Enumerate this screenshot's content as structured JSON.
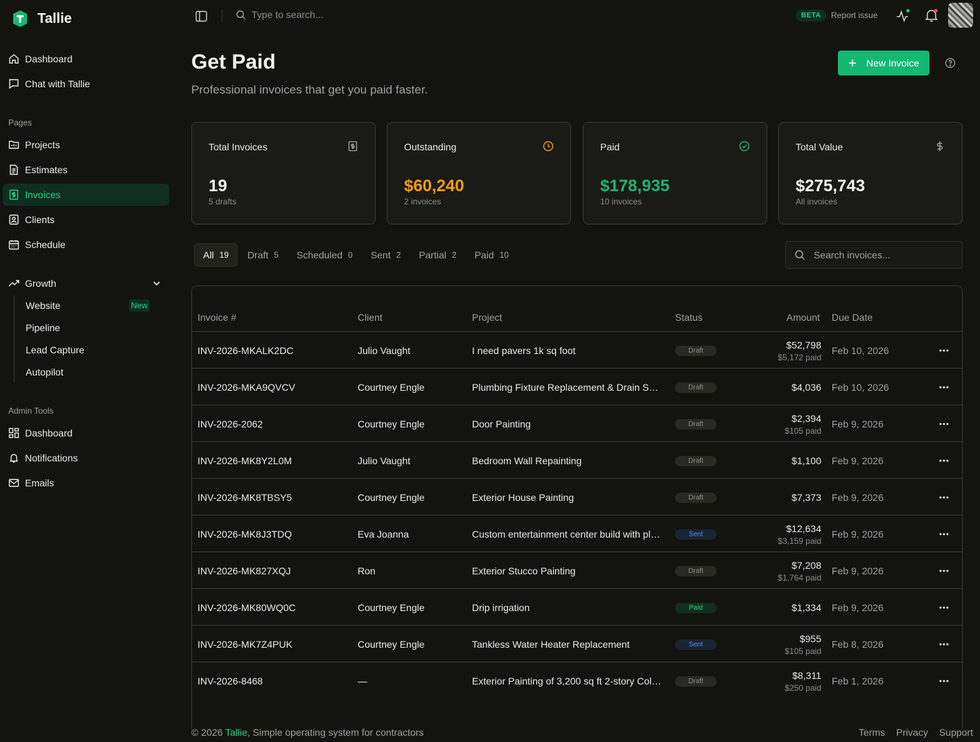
{
  "app": {
    "name": "Tallie"
  },
  "topbar": {
    "search_placeholder": "Type to search...",
    "beta": "BETA",
    "report": "Report issue"
  },
  "sidebar": {
    "main": [
      {
        "label": "Dashboard",
        "icon": "home-icon"
      },
      {
        "label": "Chat with Tallie",
        "icon": "chat-icon"
      }
    ],
    "pages_label": "Pages",
    "pages": [
      {
        "label": "Projects",
        "icon": "folder-icon"
      },
      {
        "label": "Estimates",
        "icon": "document-icon"
      },
      {
        "label": "Invoices",
        "icon": "invoice-icon",
        "active": true
      },
      {
        "label": "Clients",
        "icon": "contact-icon"
      },
      {
        "label": "Schedule",
        "icon": "calendar-icon"
      }
    ],
    "growth": {
      "label": "Growth",
      "items": [
        "Website",
        "Pipeline",
        "Lead Capture",
        "Autopilot"
      ],
      "new_badge": "New"
    },
    "admin_label": "Admin Tools",
    "admin": [
      {
        "label": "Dashboard",
        "icon": "grid-icon"
      },
      {
        "label": "Notifications",
        "icon": "bell-icon"
      },
      {
        "label": "Emails",
        "icon": "mail-icon"
      }
    ]
  },
  "page": {
    "title": "Get Paid",
    "subtitle": "Professional invoices that get you paid faster.",
    "new_button": "New Invoice"
  },
  "stats": [
    {
      "title": "Total Invoices",
      "value": "19",
      "sub": "5 drafts",
      "color": "#f2f2ee",
      "icon": "invoice-icon"
    },
    {
      "title": "Outstanding",
      "value": "$60,240",
      "sub": "2 invoices",
      "color": "#f59e0b",
      "icon": "clock-icon"
    },
    {
      "title": "Paid",
      "value": "$178,935",
      "sub": "10 invoices",
      "color": "#1bb673",
      "icon": "check-circle-icon"
    },
    {
      "title": "Total Value",
      "value": "$275,743",
      "sub": "All invoices",
      "color": "#f2f2ee",
      "icon": "dollar-icon"
    }
  ],
  "tabs": [
    {
      "label": "All",
      "count": "19"
    },
    {
      "label": "Draft",
      "count": "5"
    },
    {
      "label": "Scheduled",
      "count": "0"
    },
    {
      "label": "Sent",
      "count": "2"
    },
    {
      "label": "Partial",
      "count": "2"
    },
    {
      "label": "Paid",
      "count": "10"
    }
  ],
  "search_invoices_placeholder": "Search invoices...",
  "table": {
    "headers": {
      "invoice": "Invoice #",
      "client": "Client",
      "project": "Project",
      "status": "Status",
      "amount": "Amount",
      "due": "Due Date"
    },
    "rows": [
      {
        "invoice": "INV-2026-MKALK2DC",
        "client": "Julio Vaught",
        "project": "I need pavers 1k sq foot",
        "status": "Draft",
        "amount": "$52,798",
        "paid": "$5,172 paid",
        "due": "Feb 10, 2026"
      },
      {
        "invoice": "INV-2026-MKA9QVCV",
        "client": "Courtney Engle",
        "project": "Plumbing Fixture Replacement & Drain S…",
        "status": "Draft",
        "amount": "$4,036",
        "paid": "",
        "due": "Feb 10, 2026"
      },
      {
        "invoice": "INV-2026-2062",
        "client": "Courtney Engle",
        "project": "Door Painting",
        "status": "Draft",
        "amount": "$2,394",
        "paid": "$105 paid",
        "due": "Feb 9, 2026"
      },
      {
        "invoice": "INV-2026-MK8Y2L0M",
        "client": "Julio Vaught",
        "project": "Bedroom Wall Repainting",
        "status": "Draft",
        "amount": "$1,100",
        "paid": "",
        "due": "Feb 9, 2026"
      },
      {
        "invoice": "INV-2026-MK8TBSY5",
        "client": "Courtney Engle",
        "project": "Exterior House Painting",
        "status": "Draft",
        "amount": "$7,373",
        "paid": "",
        "due": "Feb 9, 2026"
      },
      {
        "invoice": "INV-2026-MK8J3TDQ",
        "client": "Eva Joanna",
        "project": "Custom entertainment center build with pl…",
        "status": "Sent",
        "amount": "$12,634",
        "paid": "$3,159 paid",
        "due": "Feb 9, 2026"
      },
      {
        "invoice": "INV-2026-MK827XQJ",
        "client": "Ron",
        "project": "Exterior Stucco Painting",
        "status": "Draft",
        "amount": "$7,208",
        "paid": "$1,764 paid",
        "due": "Feb 9, 2026"
      },
      {
        "invoice": "INV-2026-MK80WQ0C",
        "client": "Courtney Engle",
        "project": "Drip irrigation",
        "status": "Paid",
        "amount": "$1,334",
        "paid": "",
        "due": "Feb 9, 2026"
      },
      {
        "invoice": "INV-2026-MK7Z4PUK",
        "client": "Courtney Engle",
        "project": "Tankless Water Heater Replacement",
        "status": "Sent",
        "amount": "$955",
        "paid": "$105 paid",
        "due": "Feb 8, 2026"
      },
      {
        "invoice": "INV-2026-8468",
        "client": "—",
        "project": "Exterior Painting of 3,200 sq ft 2-story Col…",
        "status": "Draft",
        "amount": "$8,311",
        "paid": "$250 paid",
        "due": "Feb 1, 2026"
      }
    ]
  },
  "footer": {
    "copyright": "© 2026 ",
    "brand": "Tallie",
    "tagline": ", Simple operating system for contractors",
    "links": [
      "Terms",
      "Privacy",
      "Support"
    ]
  },
  "colors": {
    "accent": "#14b872",
    "accent_text": "#2bd08a",
    "bg": "#13130f"
  }
}
